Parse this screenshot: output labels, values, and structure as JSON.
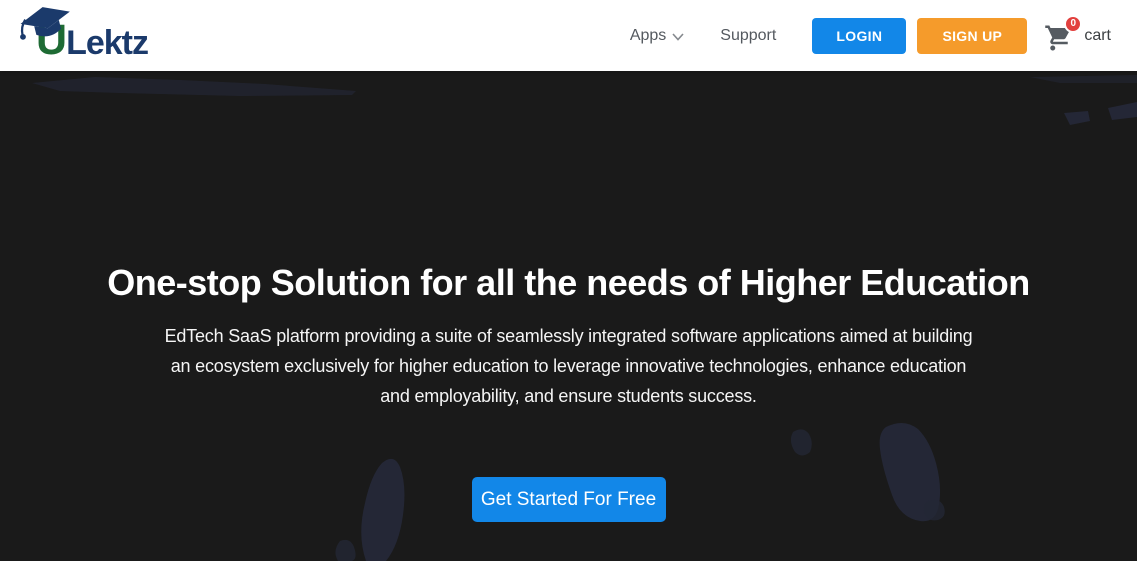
{
  "header": {
    "logo": {
      "brand_first": "U",
      "brand_rest": "Lektz"
    },
    "nav": [
      {
        "label": "Apps",
        "has_dropdown": true
      },
      {
        "label": "Support",
        "has_dropdown": false
      }
    ],
    "auth": {
      "login_label": "LOGIN",
      "signup_label": "SIGN UP"
    },
    "cart": {
      "count": "0",
      "label": "cart"
    }
  },
  "hero": {
    "title": "One-stop Solution for all the needs of Higher Education",
    "description_lines": [
      "EdTech SaaS platform providing a suite of seamlessly integrated software applications aimed at building",
      "an ecosystem exclusively for higher education to leverage innovative technologies, enhance education",
      "and employability, and ensure students success."
    ],
    "cta_label": "Get Started For Free"
  },
  "icons": {
    "logo_cap": "graduation-cap-icon",
    "nav_chevron": "chevron-down-icon",
    "cart": "shopping-cart-icon"
  },
  "colors": {
    "primary_blue": "#1287e8",
    "signup_orange": "#f59b2b",
    "badge_red": "#e2403e",
    "logo_green": "#1e6b34",
    "logo_navy": "#1b3a6b",
    "hero_background": "#1a1a1a",
    "map_shape": "#262a3b",
    "nav_text": "#54595f"
  }
}
